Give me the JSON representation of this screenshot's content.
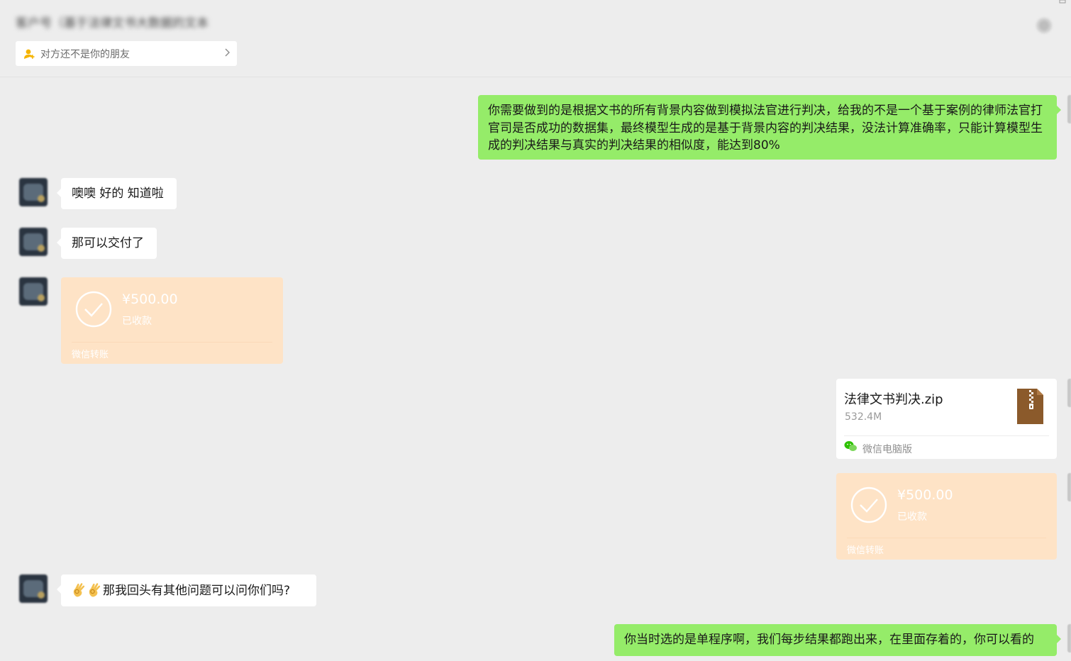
{
  "header": {
    "title": "客户号（基于法律文书大数据的文本",
    "friend_notice": "对方还不是你的朋友"
  },
  "messages": {
    "m1": "你需要做到的是根据文书的所有背景内容做到模拟法官进行判决，给我的不是一个基于案例的律师法官打官司是否成功的数据集，最终模型生成的是基于背景内容的判决结果，没法计算准确率，只能计算模型生成的判决结果与真实的判决结果的相似度，能达到80%",
    "m2": "噢噢 好的 知道啦",
    "m3": "那可以交付了",
    "m7": "那我回头有其他问题可以问你们吗?",
    "m8": "你当时选的是单程序啊，我们每步结果都跑出来，在里面存着的，你可以看的"
  },
  "transfer1": {
    "amount": "¥500.00",
    "status": "已收款",
    "footer": "微信转账"
  },
  "file": {
    "name": "法律文书判决.zip",
    "size": "532.4M",
    "source": "微信电脑版"
  },
  "transfer2": {
    "amount": "¥500.00",
    "status": "已收款",
    "footer": "微信转账"
  },
  "colors": {
    "background": "#ededed",
    "bubble_green": "#95ec69",
    "bubble_white": "#ffffff",
    "transfer_received": "#fee3c6",
    "zip_icon": "#8b5a2b"
  },
  "icons": {
    "friend_notice": "user-add-icon",
    "notice_chevron": "chevron-right-icon",
    "more": "more-icon",
    "transfer_check": "check-circle-icon",
    "file": "zip-file-icon",
    "source": "wechat-icon",
    "emoji": "ok-hand-emoji"
  }
}
